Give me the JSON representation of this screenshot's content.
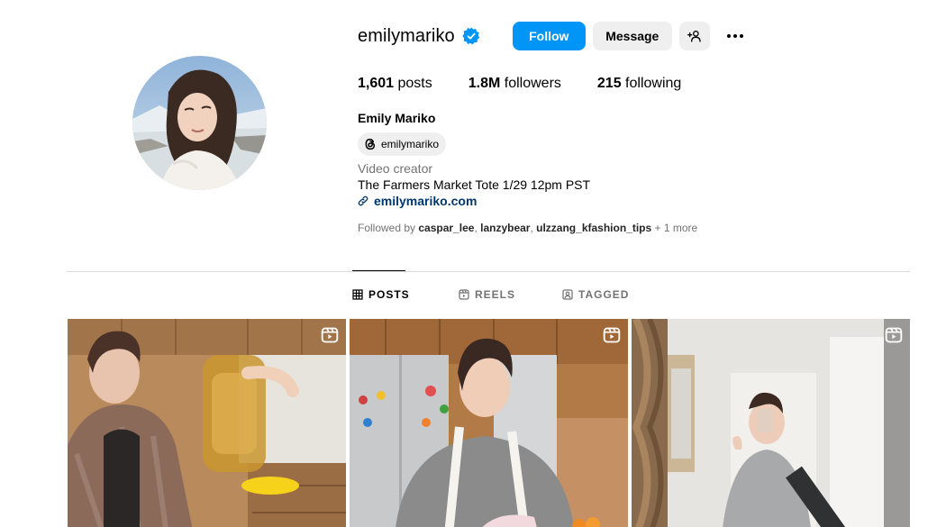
{
  "profile": {
    "username": "emilymariko",
    "full_name": "Emily Mariko",
    "threads_handle": "emilymariko",
    "category": "Video creator",
    "bio": "The Farmers Market Tote 1/29 12pm PST",
    "link": "emilymariko.com",
    "verified": true
  },
  "actions": {
    "follow": "Follow",
    "message": "Message"
  },
  "stats": {
    "posts_count": "1,601",
    "posts_label": " posts",
    "followers_count": "1.8M",
    "followers_label": " followers",
    "following_count": "215",
    "following_label": " following"
  },
  "followed_by": {
    "prefix": "Followed by ",
    "users": [
      "caspar_lee",
      "lanzybear",
      "ulzzang_kfashion_tips"
    ],
    "more": " + 1 more"
  },
  "tabs": [
    {
      "label": "POSTS",
      "icon": "grid-icon",
      "active": true
    },
    {
      "label": "REELS",
      "icon": "reels-icon",
      "active": false
    },
    {
      "label": "TAGGED",
      "icon": "tagged-icon",
      "active": false
    }
  ],
  "posts": [
    {
      "type": "reel",
      "icon": "reel-badge-icon"
    },
    {
      "type": "reel",
      "icon": "reel-badge-icon"
    },
    {
      "type": "reel",
      "icon": "reel-badge-icon"
    }
  ],
  "colors": {
    "follow_button": "#0095f6",
    "secondary_button": "#efefef",
    "link": "#00376b",
    "verified_badge": "#0095f6",
    "muted_text": "#737373"
  }
}
